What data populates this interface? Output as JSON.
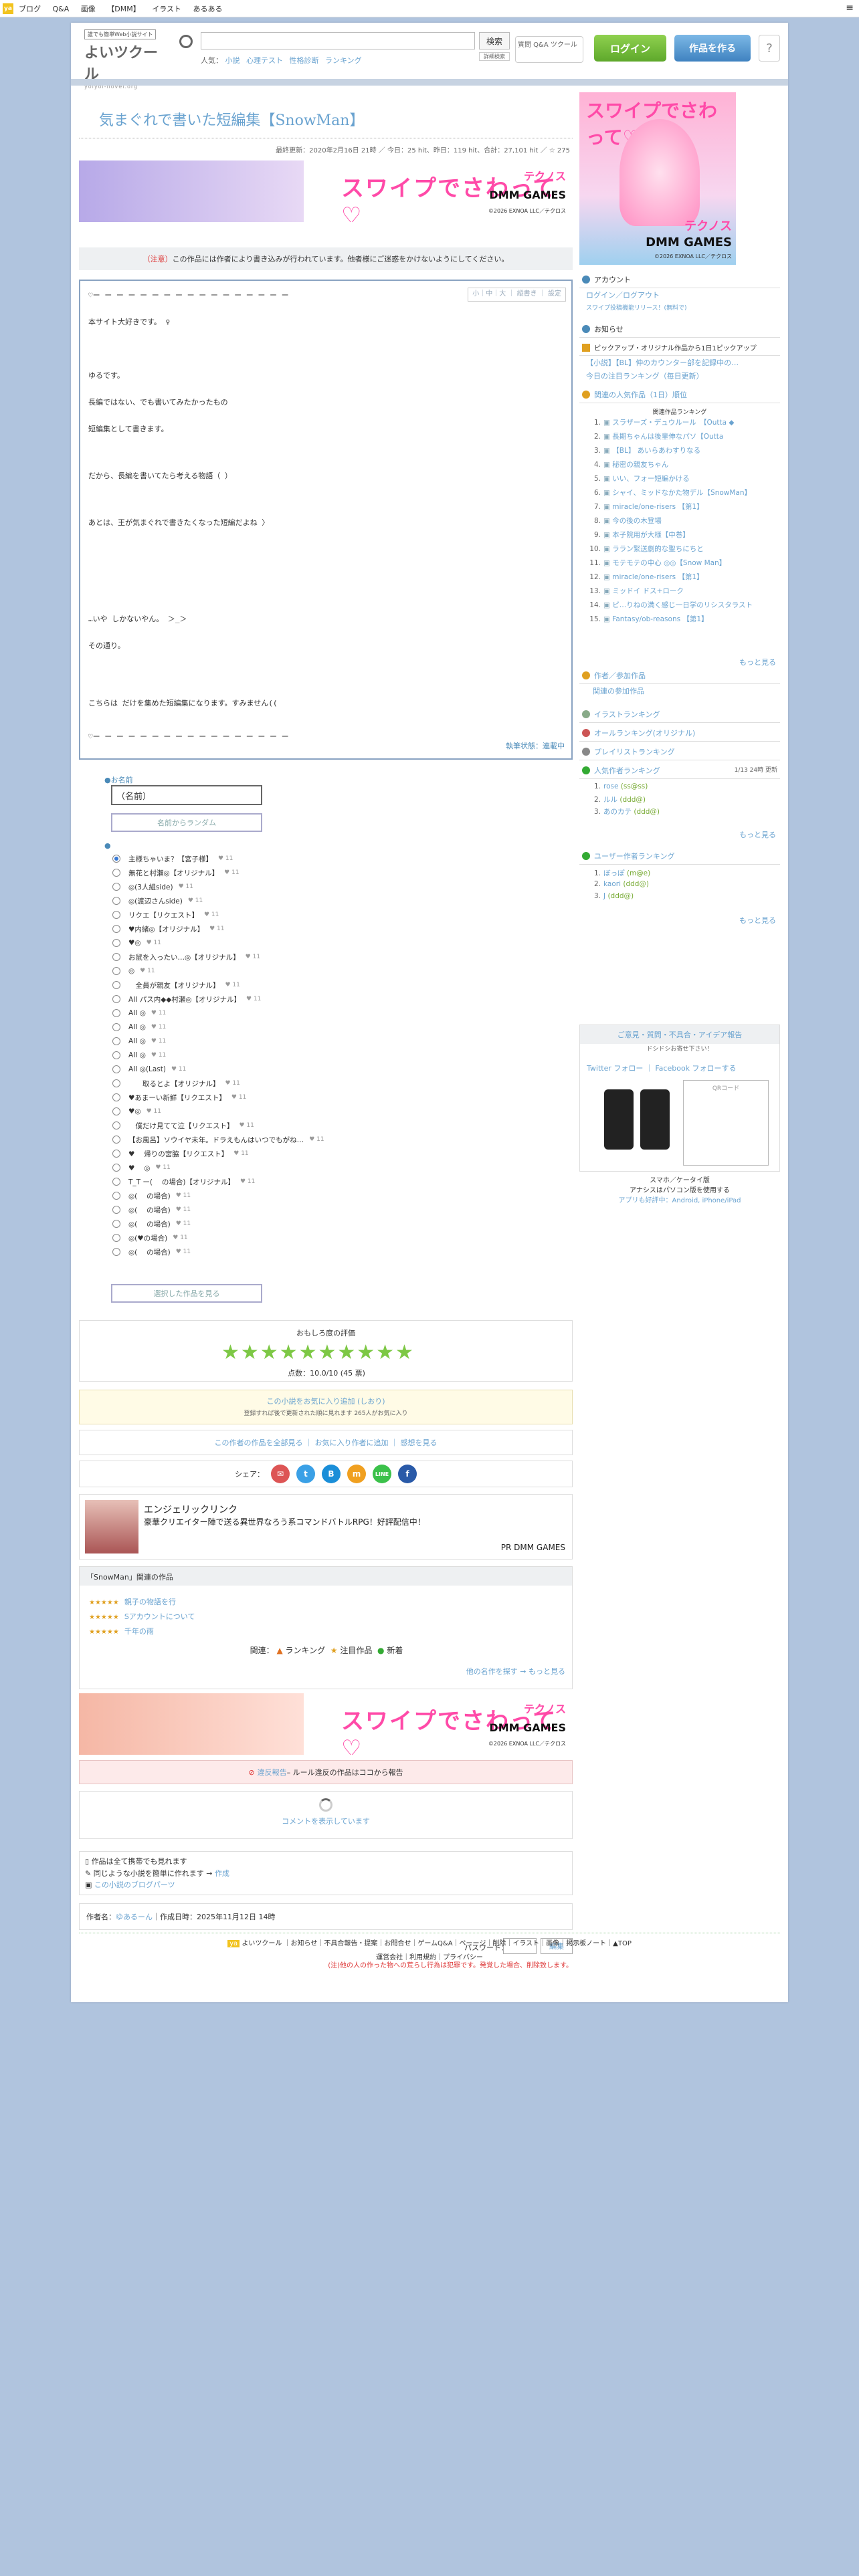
{
  "topbar": {
    "logo": "ya",
    "nav": [
      "ブログ",
      "Q&A",
      "画像",
      "【DMM】",
      "イラスト",
      "あるある"
    ],
    "menu": "≡"
  },
  "header": {
    "tagline": "誰でも簡単Web小説サイト",
    "logo": "よいツクール",
    "url": "yoiyoi-novel.org",
    "search_btn": "検索",
    "search_adv": "詳細検索",
    "search_prefix": "人気：",
    "search_tags": [
      "小説",
      "心理テスト",
      "性格診断",
      "ランキング"
    ],
    "q_label": "質問 Q&A ツクール",
    "login": "ログイン",
    "create": "作品を作る",
    "help": "?"
  },
  "work": {
    "title": "気まぐれで書いた短編集【SnowMan】",
    "meta": "最終更新：2020年2月16日 21時 ／ 今日：25 hit、昨日：119 hit、合計：27,101 hit ／ ☆ 275",
    "notice_red": "（注意）",
    "notice_text": "この作品には作者により書き込みが行われています。他者様にご迷惑をかけないようにしてください。",
    "tools": "小｜中｜大 ｜ 縦書き ｜ 設定",
    "lines": [
      "♡ー ー ー ー ー ー ー ー ー ー ー ー ー ー ー ー ー",
      "本サイト大好きです。 ♀",
      "",
      "ゆるです。",
      "長編ではない、でも書いてみたかったもの",
      "短編集として書きます。",
      "だから、長編を書いてたら考える物語（ ）",
      "あとは、王が気まぐれで書きたくなった短編だよね 〉",
      "",
      "…いや しかないやん。 ＞_＞",
      "その通り。",
      "",
      "こちらは だけを集めた短編集になります。すみません((",
      "♡ー ー ー ー ー ー ー ー ー ー ー ー ー ー ー ー ー"
    ],
    "story_foot": "執筆状態：連載中"
  },
  "vote": {
    "name_label": "●お名前",
    "name_value": "（名前）",
    "random_btn": "名前からランダム",
    "options": [
      "主様ちゃいま？【宮子様】",
      "無花と村瀬◎【オリジナル】",
      "◎(3人組side)",
      "◎(渡辺さんside)",
      "リクエ【リクエスト】",
      "♥内緒◎【オリジナル】",
      "♥◎",
      "お鼠を入ったい…◎【オリジナル】",
      "◎",
      "　全員が親友【オリジナル】",
      "AII パス内◆◆村瀬◎【オリジナル】",
      "AII ◎",
      "AII ◎",
      "AII ◎",
      "AII ◎",
      "AII ◎(Last)",
      "　　取るとよ【オリジナル】",
      "♥あまーい新鮮【リクエスト】",
      "♥◎",
      "　僕だけ見てて泣【リクエスト】",
      "【お風呂】ソウイヤ未年。ドラえもんはいつでもがね…",
      "♥ 　帰りの宮脇【リクエスト】",
      "♥ 　◎",
      "T_T ー( 　の場合)【オリジナル】",
      "◎( 　の場合)",
      "◎( 　の場合)",
      "◎( 　の場合)",
      "◎(♥の場合)",
      "◎( 　の場合)"
    ],
    "submit": "選択した作品を見る"
  },
  "rating": {
    "heading": "おもしろ度の評価",
    "stars": "★★★★★★★★★★",
    "score": "点数：10.0/10 (45 票)"
  },
  "fav": {
    "text": "この小説をお気に入り追加 (しおり)",
    "sub": "登録すれば後で更新された順に見れます 265人がお気に入り"
  },
  "links": {
    "a": "この作者の作品を全部見る",
    "b": "お気に入り作者に追加",
    "c": "感想を見る"
  },
  "share": {
    "label": "シェア：",
    "icons": [
      "✉",
      "t",
      "B",
      "m",
      "LINE",
      "f"
    ]
  },
  "ad": {
    "title": "エンジェリックリンク",
    "desc": "豪華クリエイター陣で送る異世界なろう系コマンドバトルRPG！好評配信中！",
    "pr": "PR DMM GAMES"
  },
  "related": {
    "heading": "「SnowMan」関連の作品",
    "items": [
      {
        "stars": "★★★★★",
        "title": "親子の物語を行"
      },
      {
        "stars": "★★★★★",
        "title": "Sアカウントについて"
      },
      {
        "stars": "★★★★★",
        "title": "千年の雨"
      }
    ],
    "rank_label": "関連：",
    "ranking": "ランキング",
    "attention": "注目作品",
    "new": "新着",
    "more": "他の名作を探す → もっと見る"
  },
  "banner": {
    "slogan": "スワイプでさわって♡",
    "brand": "テクノス",
    "dmm": "DMM GAMES",
    "copy": "©2026 EXNOA LLC／テクロス"
  },
  "report": {
    "link": "違反報告",
    "text": " – ルール違反の作品はココから報告"
  },
  "loading": {
    "text": "コメントを表示しています"
  },
  "mobile": {
    "l1": "作品は全て携帯でも見れます",
    "l2": "同じような小説を簡単に作れます → ",
    "l2a": "作成",
    "l3": "この小説のブログパーツ"
  },
  "author": {
    "label": "作者名：",
    "name": "ゆあるーん",
    "date": "｜作成日時：2025年11月12日 14時"
  },
  "password": {
    "label": "パスワード：",
    "btn": "編集"
  },
  "warn": "(注)他の人の作った物への荒らし行為は犯罪です。発覚した場合、削除致します。",
  "side": {
    "account": "アカウント",
    "account_links": [
      "ログイン／ログアウト",
      "スワイプ投稿機能リリース！(無料で)"
    ],
    "news": "お知らせ",
    "pickup": "ピックアップ・オリジナル作品から1日1ピックアップ",
    "pickup_l1": "【小説】【BL】仲のカウンター部を記録中の…",
    "pickup_l2": "今日の注目ランキング（毎日更新）",
    "ranking_hd": "関連の人気作品（1日）順位",
    "ranking_sub": "関連作品ランキング",
    "ranks": [
      {
        "n": "1.",
        "t": "スラザーズ・デュウルール　【Outta ◆"
      },
      {
        "n": "2.",
        "t": "長期ちゃんは後輩伸なパソ【Outta"
      },
      {
        "n": "3.",
        "t": "【BL】 あいらあわすりなる"
      },
      {
        "n": "4.",
        "t": "秘密の親友ちゃん"
      },
      {
        "n": "5.",
        "t": "いい、フォー短編かける"
      },
      {
        "n": "6.",
        "t": "シャイ、ミッドなかた物デル【SnowMan】"
      },
      {
        "n": "7.",
        "t": "miracle/one-risers 【第1】"
      },
      {
        "n": "8.",
        "t": "今の後の木登場"
      },
      {
        "n": "9.",
        "t": "本子院用が大様【中巻】"
      },
      {
        "n": "10.",
        "t": "ララン緊送劇的な聖ちにちと"
      },
      {
        "n": "11.",
        "t": "モテモテの中心 ◎◎【Snow Man】"
      },
      {
        "n": "12.",
        "t": "miracle/one-risers 【第1】"
      },
      {
        "n": "13.",
        "t": "ミッドイ ドス+ローク"
      },
      {
        "n": "14.",
        "t": "ピ…りねの満く感じ一日学のリシスタラスト"
      },
      {
        "n": "15.",
        "t": "Fantasy/ob-reasons 【第1】"
      }
    ],
    "more": "もっと見る",
    "tags": "作者／参加作品",
    "tags_l": "関連の参加作品",
    "illust": "イラストランキング",
    "complete": "オールランキング(オリジナル)",
    "play": "プレイリストランキング",
    "popular": "人気作者ランキング",
    "popular_sub": "1/13 24時 更新",
    "popular_items": [
      {
        "n": "1.",
        "t": "rose",
        "x": "(ss@ss)"
      },
      {
        "n": "2.",
        "t": "ルル",
        "x": "(ddd@)"
      },
      {
        "n": "3.",
        "t": "あのカテ",
        "x": "(ddd@)"
      }
    ],
    "user": "ユーザー作者ランキング",
    "user_items": [
      {
        "n": "1.",
        "t": "ぼっぽ",
        "x": "(m@e)"
      },
      {
        "n": "2.",
        "t": "kaori",
        "x": "(ddd@)"
      },
      {
        "n": "3.",
        "t": "J",
        "x": "(ddd@)"
      }
    ],
    "app_hd": "ご意見・質問・不具合・アイデア報告",
    "app_sub": "ドシドシお寄せ下さい！",
    "sns": "Twitter フォロー ｜ Facebook フォローする",
    "cap1": "スマホ／ケータイ版",
    "cap2": "アナシスはパソコン版を使用する",
    "cap3": "アプリも好評中：Android, iPhone/iPad",
    "qr": "QRコード"
  },
  "footer": {
    "logo": "よいツクール",
    "links": "｜お知らせ｜不具合報告・提案｜お問合せ｜ゲームQ&A｜ペーージ｜削除｜イラスト｜画像｜掲示板ノート｜▲TOP",
    "sub": "運営会社｜利用規約｜プライバシー"
  }
}
